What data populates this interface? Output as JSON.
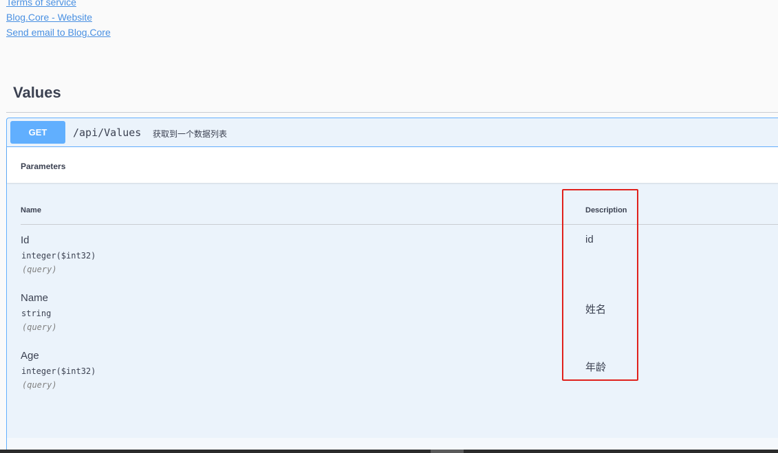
{
  "info_links": {
    "terms": "Terms of service",
    "website": "Blog.Core - Website",
    "email": "Send email to Blog.Core"
  },
  "tag": {
    "title": "Values"
  },
  "operation": {
    "method": "GET",
    "path": "/api/Values",
    "summary": "获取到一个数据列表",
    "parameters_title": "Parameters",
    "columns": {
      "name": "Name",
      "description": "Description"
    },
    "parameters": [
      {
        "name": "Id",
        "type": "integer($int32)",
        "in": "(query)",
        "description": "id"
      },
      {
        "name": "Name",
        "type": "string",
        "in": "(query)",
        "description": "姓名"
      },
      {
        "name": "Age",
        "type": "integer($int32)",
        "in": "(query)",
        "description": "年龄"
      }
    ]
  },
  "colors": {
    "get_accent": "#61affe",
    "get_background": "#ebf3fb",
    "link": "#4990e2",
    "annotation_box": "#e0201b"
  }
}
